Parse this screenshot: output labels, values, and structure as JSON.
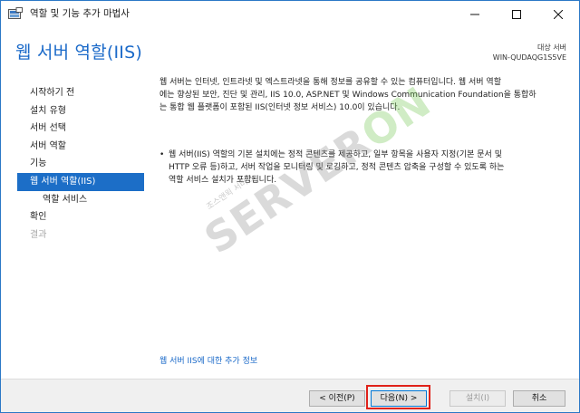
{
  "window": {
    "title": "역할 및 기능 추가 마법사"
  },
  "header": {
    "page_title": "웹 서버 역할(IIS)",
    "target_label": "대상 서버",
    "target_value": "WIN-QUDAQG1S5VE"
  },
  "sidebar": {
    "items": [
      {
        "label": "시작하기 전",
        "state": "normal"
      },
      {
        "label": "설치 유형",
        "state": "normal"
      },
      {
        "label": "서버 선택",
        "state": "normal"
      },
      {
        "label": "서버 역할",
        "state": "normal"
      },
      {
        "label": "기능",
        "state": "normal"
      },
      {
        "label": "웹 서버 역할(IIS)",
        "state": "active"
      },
      {
        "label": "역할 서비스",
        "state": "sub"
      },
      {
        "label": "확인",
        "state": "normal"
      },
      {
        "label": "결과",
        "state": "disabled"
      }
    ]
  },
  "content": {
    "intro_lines": [
      "웹 서버는 인터넷, 인트라넷 및 엑스트라넷을 통해 정보를 공유할 수 있는 컴퓨터입니다. 웹 서버 역할",
      "에는 향상된 보안, 진단 및 관리, IIS 10.0, ASP.NET 및 Windows Communication Foundation을 통합하",
      "는 통합 웹 플랫폼이 포함된 IIS(인터넷 정보 서비스) 10.0이 있습니다."
    ],
    "bullet_lines": [
      "웹 서버(IIS) 역할의 기본 설치에는 정적 콘텐츠를 제공하고, 일부 항목을 사용자 지정(기본 문서 및",
      "HTTP 오류 등)하고, 서버 작업을 모니터링 및 로깅하고, 정적 콘텐츠 압축을 구성할 수 있도록 하는",
      "역할 서비스 설치가 포함됩니다."
    ],
    "more_link": "웹 서버 IIS에 대한 추가 정보"
  },
  "footer": {
    "prev_label": "< 이전(P)",
    "next_label": "다음(N) >",
    "install_label": "설치(I)",
    "cancel_label": "취소"
  },
  "watermark": {
    "main_a": "SERVER",
    "main_b": "ON",
    "sub": "조스앤윅 서버온"
  },
  "colors": {
    "accent": "#1c6ec7",
    "highlight": "#e0221a",
    "link": "#1b6ac9"
  },
  "icons": {
    "app": "server-manager-icon",
    "minimize": "minimize-icon",
    "maximize": "maximize-icon",
    "close": "close-icon"
  }
}
